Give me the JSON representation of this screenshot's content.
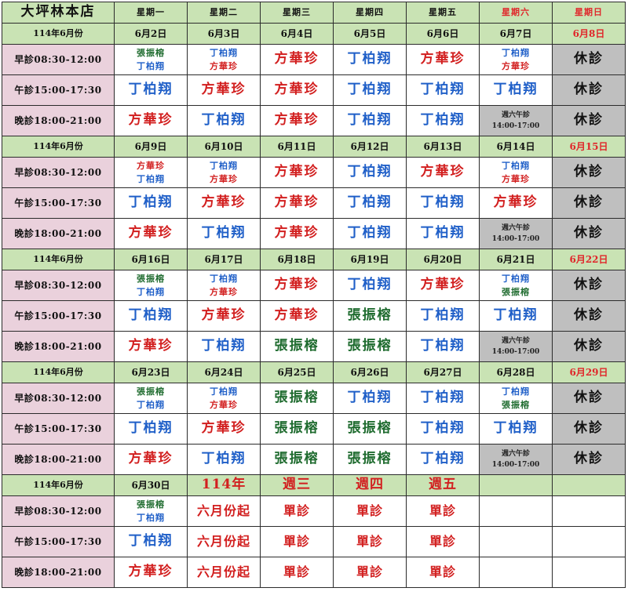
{
  "store": "大坪林本店",
  "weekdays": [
    "星期一",
    "星期二",
    "星期三",
    "星期四",
    "星期五",
    "星期六",
    "星期日"
  ],
  "closed_label": "休診",
  "saturday_note": [
    "週六午診",
    "14:00-17:00"
  ],
  "weeks": [
    {
      "month": "114年6月份",
      "dates": [
        "6月2日",
        "6月3日",
        "6月4日",
        "6月5日",
        "6月6日",
        "6月7日",
        "6月8日"
      ],
      "slots": [
        {
          "label": "早診08:30-12:00",
          "cells": [
            {
              "doctors": [
                "張振榕",
                "丁柏翔"
              ]
            },
            {
              "doctors": [
                "丁柏翔",
                "方華珍"
              ]
            },
            {
              "doctors": [
                "方華珍"
              ]
            },
            {
              "doctors": [
                "丁柏翔"
              ]
            },
            {
              "doctors": [
                "方華珍"
              ]
            },
            {
              "doctors": [
                "丁柏翔",
                "方華珍"
              ]
            },
            {
              "closed": true
            }
          ]
        },
        {
          "label": "午診15:00-17:30",
          "cells": [
            {
              "doctors": [
                "丁柏翔"
              ]
            },
            {
              "doctors": [
                "方華珍"
              ]
            },
            {
              "doctors": [
                "方華珍"
              ]
            },
            {
              "doctors": [
                "丁柏翔"
              ]
            },
            {
              "doctors": [
                "丁柏翔"
              ]
            },
            {
              "doctors": [
                "丁柏翔"
              ]
            },
            {
              "closed": true
            }
          ]
        },
        {
          "label": "晚診18:00-21:00",
          "cells": [
            {
              "doctors": [
                "方華珍"
              ]
            },
            {
              "doctors": [
                "丁柏翔"
              ]
            },
            {
              "doctors": [
                "方華珍"
              ]
            },
            {
              "doctors": [
                "丁柏翔"
              ]
            },
            {
              "doctors": [
                "丁柏翔"
              ]
            },
            {
              "satnote": true
            },
            {
              "closed": true
            }
          ]
        }
      ]
    },
    {
      "month": "114年6月份",
      "dates": [
        "6月9日",
        "6月10日",
        "6月11日",
        "6月12日",
        "6月13日",
        "6月14日",
        "6月15日"
      ],
      "slots": [
        {
          "label": "早診08:30-12:00",
          "cells": [
            {
              "doctors": [
                "方華珍",
                "丁柏翔"
              ]
            },
            {
              "doctors": [
                "丁柏翔",
                "方華珍"
              ]
            },
            {
              "doctors": [
                "方華珍"
              ]
            },
            {
              "doctors": [
                "丁柏翔"
              ]
            },
            {
              "doctors": [
                "方華珍"
              ]
            },
            {
              "doctors": [
                "丁柏翔",
                "方華珍"
              ]
            },
            {
              "closed": true
            }
          ]
        },
        {
          "label": "午診15:00-17:30",
          "cells": [
            {
              "doctors": [
                "丁柏翔"
              ]
            },
            {
              "doctors": [
                "方華珍"
              ]
            },
            {
              "doctors": [
                "方華珍"
              ]
            },
            {
              "doctors": [
                "丁柏翔"
              ]
            },
            {
              "doctors": [
                "丁柏翔"
              ]
            },
            {
              "doctors": [
                "方華珍"
              ]
            },
            {
              "closed": true
            }
          ]
        },
        {
          "label": "晚診18:00-21:00",
          "cells": [
            {
              "doctors": [
                "方華珍"
              ]
            },
            {
              "doctors": [
                "丁柏翔"
              ]
            },
            {
              "doctors": [
                "方華珍"
              ]
            },
            {
              "doctors": [
                "丁柏翔"
              ]
            },
            {
              "doctors": [
                "丁柏翔"
              ]
            },
            {
              "satnote": true
            },
            {
              "closed": true
            }
          ]
        }
      ]
    },
    {
      "month": "114年6月份",
      "dates": [
        "6月16日",
        "6月17日",
        "6月18日",
        "6月19日",
        "6月20日",
        "6月21日",
        "6月22日"
      ],
      "slots": [
        {
          "label": "早診08:30-12:00",
          "cells": [
            {
              "doctors": [
                "張振榕",
                "丁柏翔"
              ]
            },
            {
              "doctors": [
                "丁柏翔",
                "方華珍"
              ]
            },
            {
              "doctors": [
                "方華珍"
              ]
            },
            {
              "doctors": [
                "丁柏翔"
              ]
            },
            {
              "doctors": [
                "方華珍"
              ]
            },
            {
              "doctors": [
                "丁柏翔",
                "張振榕"
              ]
            },
            {
              "closed": true
            }
          ]
        },
        {
          "label": "午診15:00-17:30",
          "cells": [
            {
              "doctors": [
                "丁柏翔"
              ]
            },
            {
              "doctors": [
                "方華珍"
              ]
            },
            {
              "doctors": [
                "方華珍"
              ]
            },
            {
              "doctors": [
                "張振榕"
              ]
            },
            {
              "doctors": [
                "丁柏翔"
              ]
            },
            {
              "doctors": [
                "丁柏翔"
              ]
            },
            {
              "closed": true
            }
          ]
        },
        {
          "label": "晚診18:00-21:00",
          "cells": [
            {
              "doctors": [
                "方華珍"
              ]
            },
            {
              "doctors": [
                "丁柏翔"
              ]
            },
            {
              "doctors": [
                "張振榕"
              ]
            },
            {
              "doctors": [
                "張振榕"
              ]
            },
            {
              "doctors": [
                "丁柏翔"
              ]
            },
            {
              "satnote": true
            },
            {
              "closed": true
            }
          ]
        }
      ]
    },
    {
      "month": "114年6月份",
      "dates": [
        "6月23日",
        "6月24日",
        "6月25日",
        "6月26日",
        "6月27日",
        "6月28日",
        "6月29日"
      ],
      "slots": [
        {
          "label": "早診08:30-12:00",
          "cells": [
            {
              "doctors": [
                "張振榕",
                "丁柏翔"
              ]
            },
            {
              "doctors": [
                "丁柏翔",
                "方華珍"
              ]
            },
            {
              "doctors": [
                "張振榕"
              ]
            },
            {
              "doctors": [
                "丁柏翔"
              ]
            },
            {
              "doctors": [
                "丁柏翔"
              ]
            },
            {
              "doctors": [
                "丁柏翔",
                "張振榕"
              ]
            },
            {
              "closed": true
            }
          ]
        },
        {
          "label": "午診15:00-17:30",
          "cells": [
            {
              "doctors": [
                "丁柏翔"
              ]
            },
            {
              "doctors": [
                "方華珍"
              ]
            },
            {
              "doctors": [
                "張振榕"
              ]
            },
            {
              "doctors": [
                "張振榕"
              ]
            },
            {
              "doctors": [
                "丁柏翔"
              ]
            },
            {
              "doctors": [
                "丁柏翔"
              ]
            },
            {
              "closed": true
            }
          ]
        },
        {
          "label": "晚診18:00-21:00",
          "cells": [
            {
              "doctors": [
                "方華珍"
              ]
            },
            {
              "doctors": [
                "丁柏翔"
              ]
            },
            {
              "doctors": [
                "張振榕"
              ]
            },
            {
              "doctors": [
                "張振榕"
              ]
            },
            {
              "doctors": [
                "丁柏翔"
              ]
            },
            {
              "satnote": true
            },
            {
              "closed": true
            }
          ]
        }
      ]
    }
  ],
  "last_week": {
    "month": "114年6月份",
    "date": "6月30日",
    "notice_headers": [
      "114年",
      "週三",
      "週四",
      "週五"
    ],
    "slots": [
      {
        "label": "早診08:30-12:00",
        "doctors": [
          "張振榕",
          "丁柏翔"
        ],
        "notices": [
          "六月份起",
          "單診",
          "單診",
          "單診"
        ]
      },
      {
        "label": "午診15:00-17:30",
        "doctors": [
          "丁柏翔"
        ],
        "notices": [
          "六月份起",
          "單診",
          "單診",
          "單診"
        ]
      },
      {
        "label": "晚診18:00-21:00",
        "doctors": [
          "方華珍"
        ],
        "notices": [
          "六月份起",
          "單診",
          "單診",
          "單診"
        ]
      }
    ]
  },
  "colors": {
    "丁柏翔": "#1f5fc8",
    "方華珍": "#d21f1f",
    "張振榕": "#1e6b2e",
    "header_bg": "#c9e3b4",
    "label_bg": "#ead1dc",
    "closed_bg": "#bfbfbf"
  }
}
